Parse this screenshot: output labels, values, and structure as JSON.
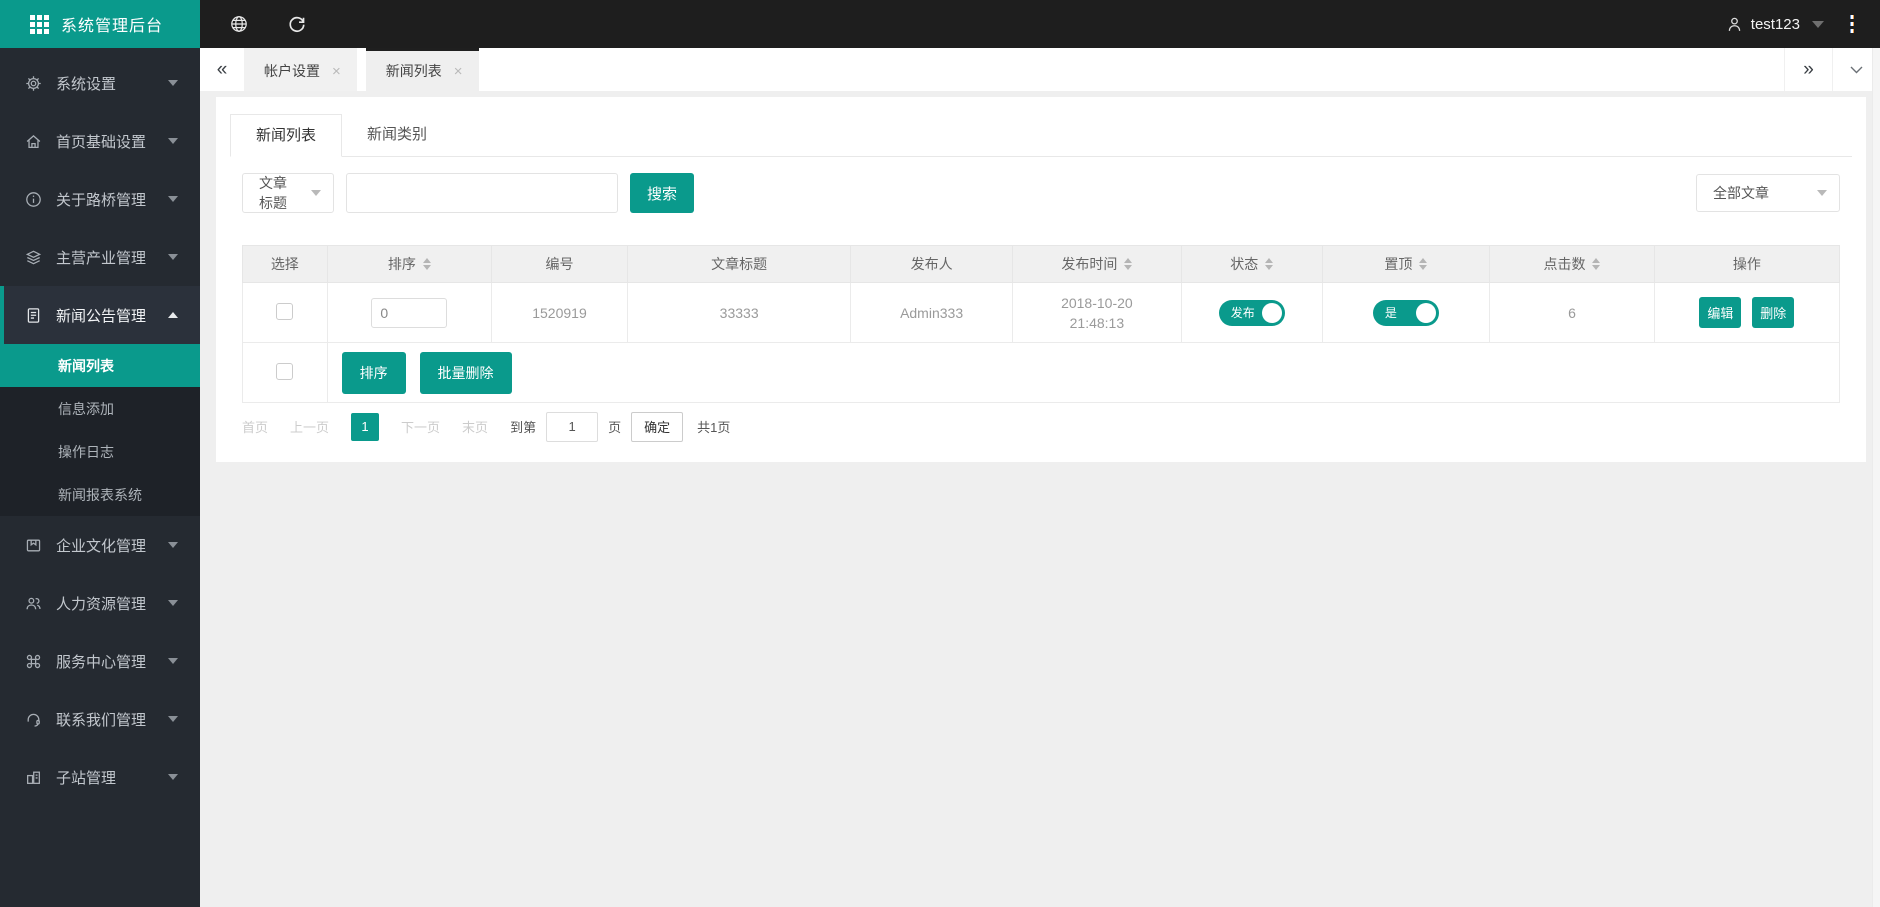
{
  "colors": {
    "accent": "#0a9a8c",
    "topbar_bg": "#1e1e1e",
    "sidebar_bg": "#252a31",
    "submenu_bg": "#1e2228",
    "content_bg": "#efefef",
    "active_tab_border": "#1f1f1f"
  },
  "icons": {
    "logo": "grid-icon",
    "topbar_left": [
      "globe-icon",
      "refresh-icon"
    ],
    "user": "user-icon",
    "more": "kebab-icon",
    "sidebar": [
      "gear-icon",
      "home-icon",
      "info-icon",
      "layers-icon",
      "document-icon",
      "flag-icon",
      "people-icon",
      "command-icon",
      "headset-icon",
      "building-icon"
    ]
  },
  "app": {
    "title": "系统管理后台"
  },
  "topbar": {
    "username": "test123"
  },
  "sidebar": {
    "items": [
      {
        "label": "系统设置"
      },
      {
        "label": "首页基础设置"
      },
      {
        "label": "关于路桥管理"
      },
      {
        "label": "主营产业管理"
      },
      {
        "label": "新闻公告管理",
        "expanded": true,
        "children": [
          {
            "label": "新闻列表",
            "active": true
          },
          {
            "label": "信息添加"
          },
          {
            "label": "操作日志"
          },
          {
            "label": "新闻报表系统"
          }
        ]
      },
      {
        "label": "企业文化管理"
      },
      {
        "label": "人力资源管理"
      },
      {
        "label": "服务中心管理"
      },
      {
        "label": "联系我们管理"
      },
      {
        "label": "子站管理"
      }
    ]
  },
  "tabbar": {
    "chevrons_left": "«",
    "chevrons_right": "»",
    "tabs": [
      {
        "label": "帐户设置",
        "close": "×"
      },
      {
        "label": "新闻列表",
        "close": "×",
        "active": true
      }
    ]
  },
  "card": {
    "tabs": [
      {
        "label": "新闻列表",
        "active": true
      },
      {
        "label": "新闻类别"
      }
    ],
    "search": {
      "category": "文章标题",
      "keyword": "",
      "button": "搜索",
      "filter": "全部文章"
    },
    "table": {
      "columns": [
        {
          "label": "选择"
        },
        {
          "label": "排序",
          "sortable": true
        },
        {
          "label": "编号"
        },
        {
          "label": "文章标题"
        },
        {
          "label": "发布人"
        },
        {
          "label": "发布时间",
          "sortable": true
        },
        {
          "label": "状态",
          "sortable": true
        },
        {
          "label": "置顶",
          "sortable": true
        },
        {
          "label": "点击数",
          "sortable": true
        },
        {
          "label": "操作"
        }
      ],
      "row": {
        "sort_value": "0",
        "id": "1520919",
        "title": "33333",
        "publisher": "Admin333",
        "publish_date": "2018-10-20",
        "publish_time": "21:48:13",
        "status_label": "发布",
        "status_on": true,
        "pinned_label": "是",
        "pinned_on": true,
        "clicks": "6",
        "edit": "编辑",
        "delete": "删除"
      },
      "batch": {
        "sort": "排序",
        "bulk_delete": "批量删除"
      }
    },
    "pagination": {
      "first": "首页",
      "prev": "上一页",
      "page": "1",
      "next": "下一页",
      "last": "末页",
      "goto_prefix": "到第",
      "goto_value": "1",
      "goto_suffix": "页",
      "confirm": "确定",
      "total": "共1页"
    }
  }
}
